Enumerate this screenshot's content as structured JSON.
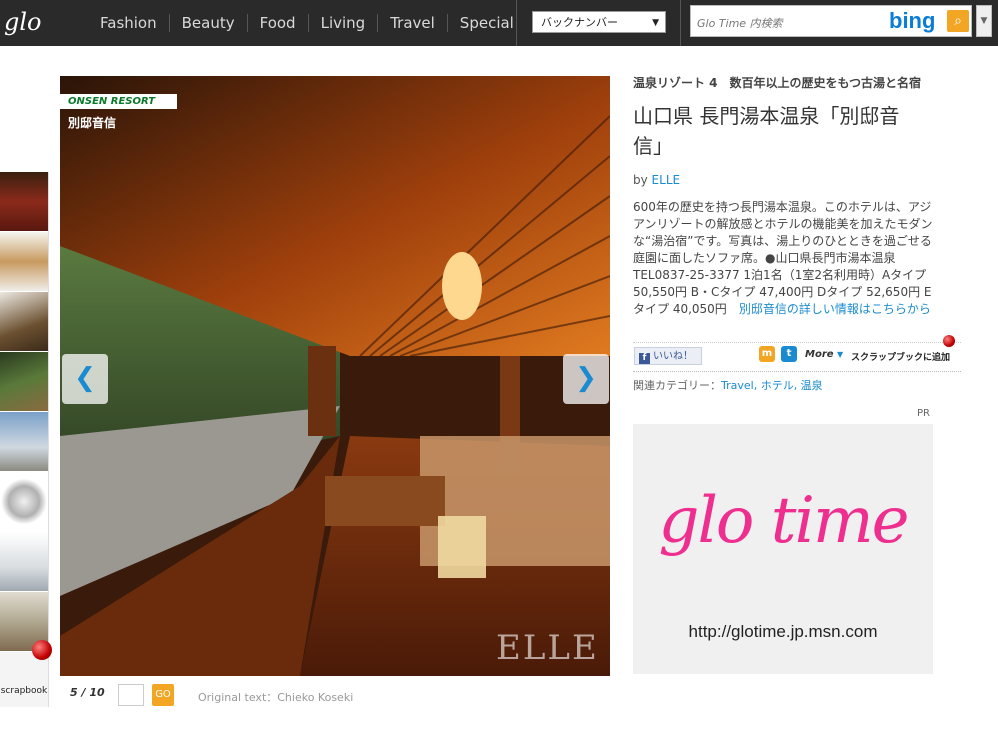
{
  "header": {
    "logo": "glo time",
    "nav": [
      "Fashion",
      "Beauty",
      "Food",
      "Living",
      "Travel",
      "Special"
    ],
    "back_numbers": "バックナンバー",
    "search_placeholder": "Glo Time 内検索",
    "search_engine": "bing"
  },
  "gallery": {
    "tag": "ONSEN RESORT",
    "subtitle": "別邸音信",
    "watermark": "ELLE",
    "pager": "5 / 10",
    "go": "GO",
    "credit": "Original text：Chieko Koseki",
    "thumbnails": [
      "#8b2a1a",
      "#c89a60",
      "#6b5030",
      "#5a7a3a",
      "#7aa0c8",
      "#b0b0b0",
      "#d8dde0",
      "#b0a890"
    ]
  },
  "scrapbook": "scrapbook",
  "article": {
    "kicker": "温泉リゾート 4　数百年以上の歴史をもつ古湯と名宿",
    "headline": "山口県 長門湯本温泉「別邸音信」",
    "by_label": "by ",
    "author": "ELLE",
    "body": "600年の歴史を持つ長門湯本温泉。このホテルは、アジアンリゾートの解放感とホテルの機能美を加えたモダンな“湯治宿”です。写真は、湯上りのひとときを過ごせる庭園に面したソファ席。●山口県長門市湯本温泉 TEL0837-25-3377 1泊1名（1室2名利用時）Aタイプ 50,550円 B・Cタイプ 47,400円 Dタイプ 52,650円 Eタイプ 40,050円　",
    "details_link": "別邸音信の詳しい情報はこちらから"
  },
  "social": {
    "like": "いいね！",
    "more": "More",
    "scrapbook_add": "スクラップブックに追加"
  },
  "related": {
    "label": "関連カテゴリー：",
    "categories": "Travel, ホテル, 温泉"
  },
  "ad": {
    "pr": "PR",
    "logo": "glo time",
    "url": "http://glotime.jp.msn.com"
  }
}
